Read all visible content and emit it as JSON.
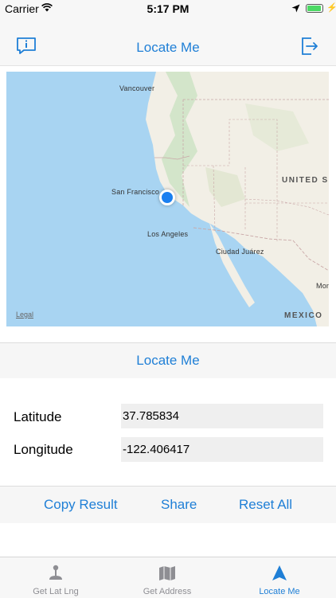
{
  "status_bar": {
    "carrier": "Carrier",
    "time": "5:17 PM"
  },
  "nav": {
    "title": "Locate Me",
    "left_icon": "info-bubble-icon",
    "right_icon": "exit-icon"
  },
  "map": {
    "cities": [
      {
        "id": "vancouver",
        "label": "Vancouver"
      },
      {
        "id": "sanfrancisco",
        "label": "San Francisco"
      },
      {
        "id": "losangeles",
        "label": "Los Angeles"
      },
      {
        "id": "ciudadjuarez",
        "label": "Ciudad Juárez"
      },
      {
        "id": "mon",
        "label": "Mon"
      }
    ],
    "countries": {
      "us": "UNITED S",
      "mexico": "MEXICO"
    },
    "legal": "Legal"
  },
  "locate_button": "Locate Me",
  "coords": {
    "latitude_label": "Latitude",
    "latitude_value": "37.785834",
    "longitude_label": "Longitude",
    "longitude_value": "-122.406417"
  },
  "actions": {
    "copy": "Copy Result",
    "share": "Share",
    "reset": "Reset All"
  },
  "tabs": [
    {
      "label": "Get Lat Lng",
      "icon": "pin-stand-icon",
      "active": false
    },
    {
      "label": "Get Address",
      "icon": "map-icon",
      "active": false
    },
    {
      "label": "Locate Me",
      "icon": "location-arrow-icon",
      "active": true
    }
  ],
  "colors": {
    "accent": "#1f7fd6",
    "water": "#a8d4f2",
    "land": "#f2efe6",
    "user_dot": "#1a7ff0",
    "inactive_tab": "#8e8e93"
  }
}
